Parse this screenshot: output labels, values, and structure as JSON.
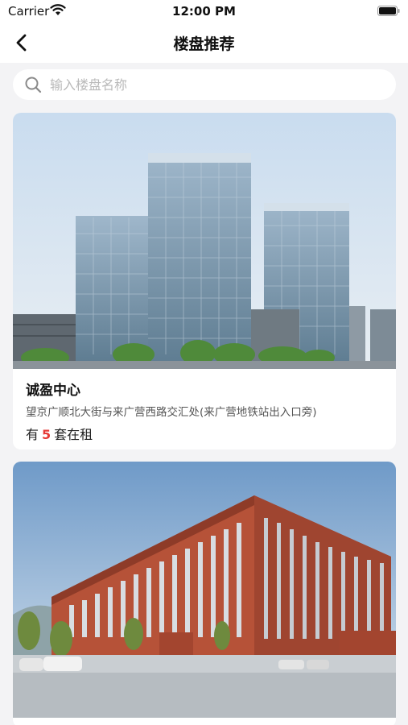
{
  "status": {
    "carrier": "Carrier",
    "time": "12:00 PM"
  },
  "nav": {
    "title": "楼盘推荐",
    "back_icon": "chevron-left-icon"
  },
  "search": {
    "placeholder": "输入楼盘名称",
    "value": ""
  },
  "listings": [
    {
      "name": "诚盈中心",
      "address": "望京广顺北大街与来广营西路交汇处(来广营地铁站出入口旁)",
      "rent_prefix": "有",
      "rent_count": "5",
      "rent_suffix": "套在租"
    },
    {
      "name": "",
      "address": ""
    }
  ],
  "colors": {
    "accent_red": "#e53935",
    "page_bg": "#f3f3f5",
    "card_bg": "#ffffff"
  }
}
